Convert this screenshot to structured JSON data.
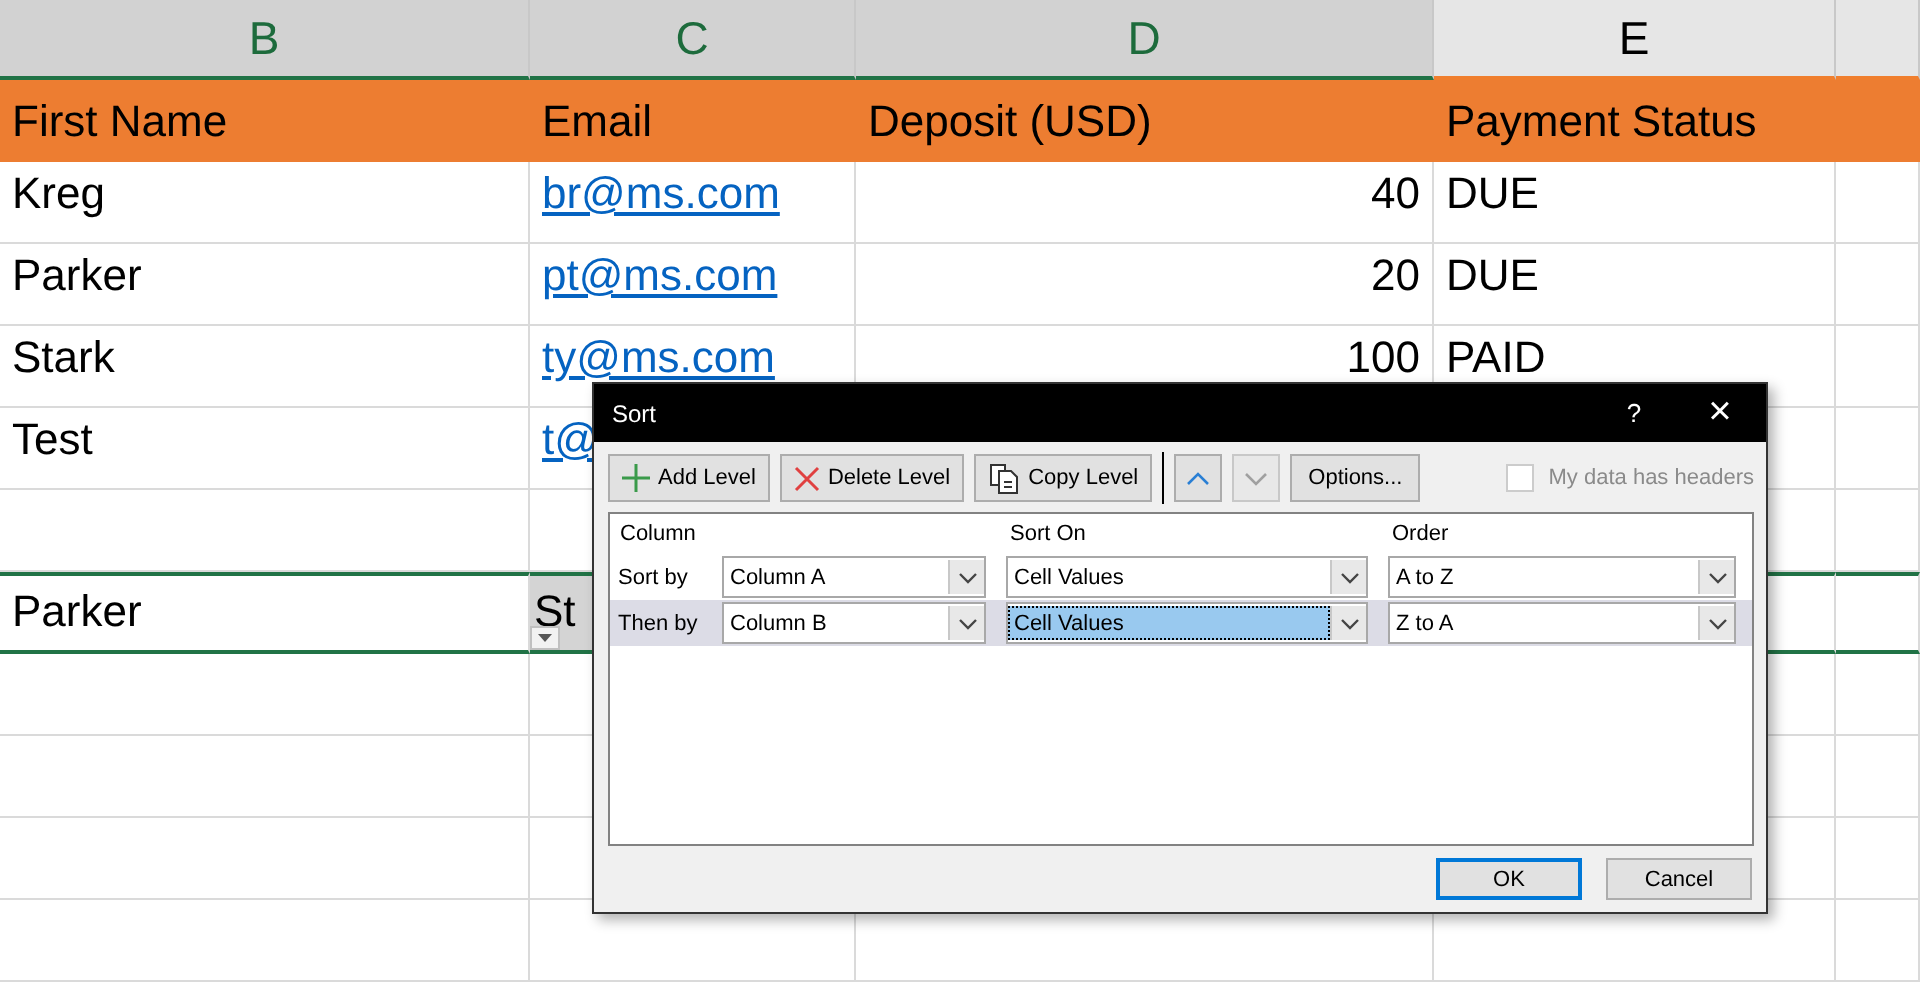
{
  "sheet": {
    "columns": [
      {
        "label": "B",
        "selected": true
      },
      {
        "label": "C",
        "selected": true
      },
      {
        "label": "D",
        "selected": true
      },
      {
        "label": "E",
        "selected": false
      }
    ],
    "rows": [
      {
        "selected": false,
        "cells": [
          {
            "kind": "header",
            "text": "First Name"
          },
          {
            "kind": "header",
            "text": "Email"
          },
          {
            "kind": "header",
            "text": "Deposit (USD)"
          },
          {
            "kind": "header",
            "text": "Payment Status"
          }
        ]
      },
      {
        "selected": false,
        "cells": [
          {
            "kind": "text",
            "text": "Kreg"
          },
          {
            "kind": "link",
            "text": "br@ms.com"
          },
          {
            "kind": "number",
            "text": "40"
          },
          {
            "kind": "text",
            "text": "DUE"
          }
        ]
      },
      {
        "selected": false,
        "cells": [
          {
            "kind": "text",
            "text": "Parker"
          },
          {
            "kind": "link",
            "text": "pt@ms.com"
          },
          {
            "kind": "number",
            "text": "20"
          },
          {
            "kind": "text",
            "text": "DUE"
          }
        ]
      },
      {
        "selected": false,
        "cells": [
          {
            "kind": "text",
            "text": "Stark"
          },
          {
            "kind": "link",
            "text": "ty@ms.com"
          },
          {
            "kind": "number",
            "text": "100"
          },
          {
            "kind": "text",
            "text": "PAID"
          }
        ]
      },
      {
        "selected": false,
        "cells": [
          {
            "kind": "text",
            "text": "Test"
          },
          {
            "kind": "link",
            "text": "t@"
          },
          {
            "kind": "empty"
          },
          {
            "kind": "empty"
          }
        ]
      },
      {
        "selected": false,
        "cells": [
          {
            "kind": "empty"
          },
          {
            "kind": "empty"
          },
          {
            "kind": "empty"
          },
          {
            "kind": "empty"
          }
        ]
      },
      {
        "selected": true,
        "cells": [
          {
            "kind": "text",
            "text": "Parker"
          },
          {
            "kind": "dropdown",
            "text": "St"
          },
          {
            "kind": "empty"
          },
          {
            "kind": "empty"
          }
        ]
      }
    ]
  },
  "dialog": {
    "title": "Sort",
    "help": "?",
    "close": "×",
    "toolbar": [
      {
        "kind": "add",
        "label": "Add Level"
      },
      {
        "kind": "delete",
        "label": "Delete Level"
      },
      {
        "kind": "copy",
        "label": "Copy Level"
      },
      {
        "kind": "up",
        "disabled": false
      },
      {
        "kind": "down",
        "disabled": true
      },
      {
        "kind": "options",
        "label": "Options..."
      }
    ],
    "headers_checkbox": {
      "label": "My data has headers",
      "checked": false,
      "disabled": true
    },
    "columns": [
      "Column",
      "Sort On",
      "Order"
    ],
    "levels": [
      {
        "label": "Sort by",
        "selected": false,
        "fields": [
          {
            "value": "Column A",
            "focused": false
          },
          {
            "value": "Cell Values",
            "focused": false
          },
          {
            "value": "A to Z",
            "focused": false
          }
        ]
      },
      {
        "label": "Then by",
        "selected": true,
        "fields": [
          {
            "value": "Column B",
            "focused": false
          },
          {
            "value": "Cell Values",
            "focused": true
          },
          {
            "value": "Z to A",
            "focused": false
          }
        ]
      }
    ],
    "buttons": [
      {
        "label": "OK",
        "default": true
      },
      {
        "label": "Cancel",
        "default": false
      }
    ]
  }
}
